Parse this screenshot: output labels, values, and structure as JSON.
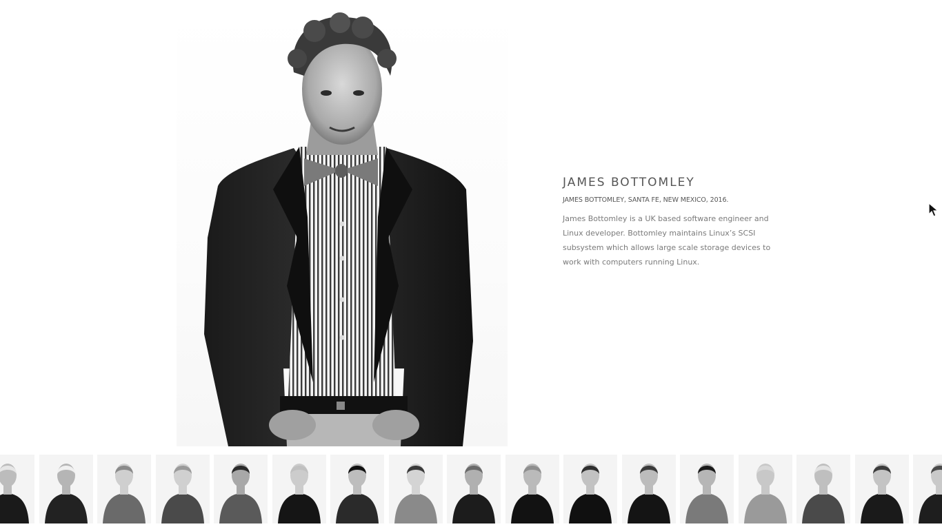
{
  "profile": {
    "name": "JAMES BOTTOMLEY",
    "caption": "JAMES BOTTOMLEY, SANTA FE, NEW MEXICO, 2016.",
    "bio": "James Bottomley is a UK based software engineer and Linux developer. Bottomley maintains Linux’s SCSI subsystem which allows large scale storage devices to work with computers running Linux."
  },
  "colors": {
    "background": "#ffffff",
    "heading": "#555555",
    "body_text": "#7a7a7a"
  },
  "thumbnails": [
    {
      "subject": "portrait",
      "shirt": "#1a1a1a",
      "hair": "#e6e6e6",
      "skin": "#bcbcbc",
      "selected": false
    },
    {
      "subject": "portrait",
      "shirt": "#222222",
      "hair": "#f0f0f0",
      "skin": "#b5b5b5",
      "selected": false
    },
    {
      "subject": "portrait",
      "shirt": "#6a6a6a",
      "hair": "#8a8a8a",
      "skin": "#cfcfcf",
      "selected": false
    },
    {
      "subject": "portrait",
      "shirt": "#4a4a4a",
      "hair": "#9a9a9a",
      "skin": "#d0d0d0",
      "selected": false
    },
    {
      "subject": "portrait",
      "shirt": "#5a5a5a",
      "hair": "#2a2a2a",
      "skin": "#a8a8a8",
      "selected": false
    },
    {
      "subject": "portrait",
      "shirt": "#151515",
      "hair": "#c0c0c0",
      "skin": "#cccccc",
      "selected": false
    },
    {
      "subject": "portrait",
      "shirt": "#2a2a2a",
      "hair": "#111111",
      "skin": "#bdbdbd",
      "selected": false
    },
    {
      "subject": "portrait",
      "shirt": "#8a8a8a",
      "hair": "#3a3a3a",
      "skin": "#d4d4d4",
      "selected": false
    },
    {
      "subject": "portrait",
      "shirt": "#1c1c1c",
      "hair": "#6a6a6a",
      "skin": "#b0b0b0",
      "selected": true
    },
    {
      "subject": "portrait",
      "shirt": "#121212",
      "hair": "#8e8e8e",
      "skin": "#bababa",
      "selected": false
    },
    {
      "subject": "portrait",
      "shirt": "#101010",
      "hair": "#2e2e2e",
      "skin": "#c2c2c2",
      "selected": false
    },
    {
      "subject": "portrait",
      "shirt": "#141414",
      "hair": "#3a3a3a",
      "skin": "#bcbcbc",
      "selected": false
    },
    {
      "subject": "portrait",
      "shirt": "#7a7a7a",
      "hair": "#1a1a1a",
      "skin": "#b6b6b6",
      "selected": false
    },
    {
      "subject": "portrait",
      "shirt": "#9a9a9a",
      "hair": "#d8d8d8",
      "skin": "#c8c8c8",
      "selected": false
    },
    {
      "subject": "portrait",
      "shirt": "#4a4a4a",
      "hair": "#e2e2e2",
      "skin": "#bfbfbf",
      "selected": false
    },
    {
      "subject": "portrait",
      "shirt": "#1a1a1a",
      "hair": "#3c3c3c",
      "skin": "#c4c4c4",
      "selected": false
    },
    {
      "subject": "portrait",
      "shirt": "#1e1e1e",
      "hair": "#4a4a4a",
      "skin": "#c9c9c9",
      "selected": false
    }
  ]
}
